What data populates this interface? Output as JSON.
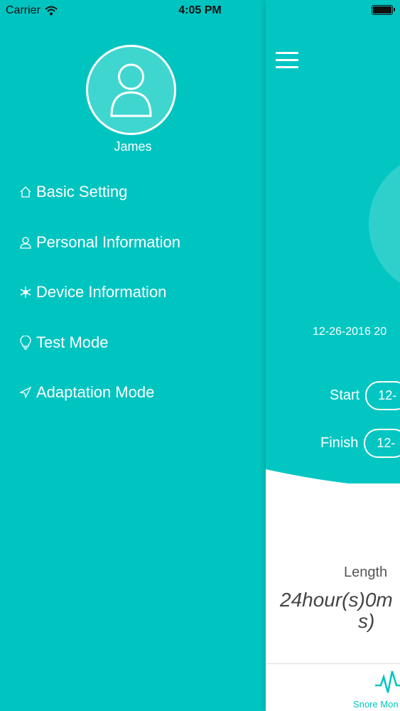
{
  "status_bar": {
    "carrier": "Carrier",
    "time": "4:05 PM"
  },
  "drawer": {
    "username": "James",
    "menu": [
      {
        "label": "Basic Setting",
        "icon": "home-icon"
      },
      {
        "label": "Personal Information",
        "icon": "person-icon"
      },
      {
        "label": "Device Information",
        "icon": "snowflake-icon"
      },
      {
        "label": "Test Mode",
        "icon": "lightbulb-icon"
      },
      {
        "label": "Adaptation Mode",
        "icon": "send-icon"
      }
    ]
  },
  "main": {
    "date_range": "12-26-2016 20",
    "start_label": "Start",
    "start_value": "12-",
    "finish_label": "Finish",
    "finish_value": "12-",
    "length_label": "Length",
    "length_value_line1": "24hour(s)0m",
    "length_value_line2": "s)",
    "tab_label": "Snore Mon"
  },
  "colors": {
    "primary": "#00c4c0",
    "white": "#ffffff"
  }
}
